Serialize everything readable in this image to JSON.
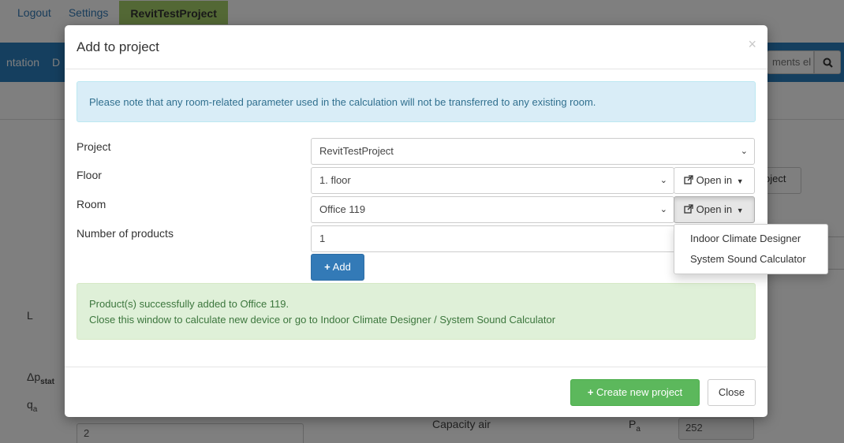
{
  "top_links": {
    "logout": "Logout",
    "settings": "Settings",
    "project": "RevitTestProject"
  },
  "navbar": {
    "left_item_1": "ntation",
    "left_item_2": "D",
    "search_placeholder": "ments el",
    "colors": {
      "primary": "#2b7fbe",
      "active_project": "#a6d06a"
    }
  },
  "background": {
    "label_L": "L",
    "label_dp": "Δp",
    "label_dp_sub": "stat",
    "label_q": "q",
    "label_q_sub": "a",
    "capacity_air_label": "Capacity air",
    "pa_label": "P",
    "pa_sub": "a",
    "pa_value": "252",
    "bottom_input_value": "2",
    "project_btn_fragment": "oject"
  },
  "modal": {
    "title": "Add to project",
    "close_symbol": "×",
    "info_text": "Please note that any room-related parameter used in the calculation will not be transferred to any existing room.",
    "fields": {
      "project_label": "Project",
      "project_value": "RevitTestProject",
      "floor_label": "Floor",
      "floor_value": "1. floor",
      "room_label": "Room",
      "room_value": "Office 119",
      "count_label": "Number of products",
      "count_value": "1"
    },
    "open_in_label": "Open in",
    "add_label": "Add",
    "success_line1": "Product(s) successfully added to Office 119.",
    "success_line2": "Close this window to calculate new device or go to Indoor Climate Designer / System Sound Calculator",
    "create_project_label": "Create new project",
    "close_label": "Close",
    "colors": {
      "info": "#d9edf7",
      "success": "#dff0d8",
      "add": "#337ab7",
      "create": "#5cb85c"
    }
  },
  "dropdown": {
    "items": [
      "Indoor Climate Designer",
      "System Sound Calculator"
    ]
  }
}
